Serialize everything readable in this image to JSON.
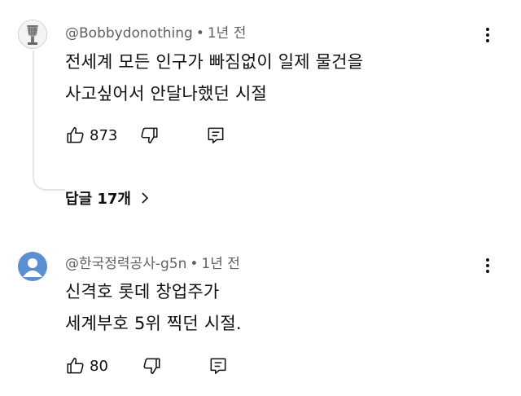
{
  "comments": [
    {
      "author": "@Bobbydonothing",
      "time": "1년 전",
      "lines": [
        "전세계 모든 인구가 빠짐없이 일제 물건을",
        "사고싶어서 안달나했던 시절"
      ],
      "likes": "873",
      "replies_label": "답글 17개"
    },
    {
      "author": "@한국정력공사-g5n",
      "time": "1년 전",
      "lines": [
        "신격호 롯데 창업주가",
        "세계부호 5위 찍던 시절."
      ],
      "likes": "80"
    }
  ],
  "separator": "•",
  "icons": [
    "thumbs-up-icon",
    "thumbs-down-icon",
    "reply-icon",
    "more-vertical-icon",
    "chevron-right-icon",
    "default-avatar-icon"
  ],
  "colors": {
    "meta": "#606060",
    "avatar_blue": "#5b8fcf",
    "thread_line": "#e5e5e5"
  }
}
